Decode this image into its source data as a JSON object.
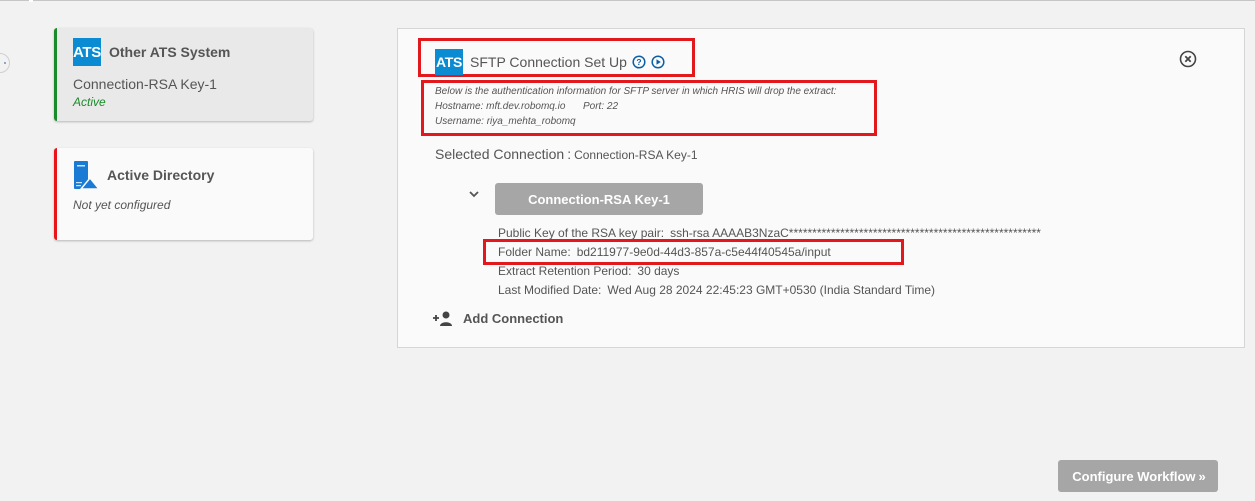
{
  "sidebar": {
    "cards": [
      {
        "logo_text": "ATS",
        "title": "Other ATS System",
        "connection": "Connection-RSA Key-1",
        "status": "Active",
        "status_color": "#1a8a2a",
        "accent": "#1a8a2a",
        "icon": "ats-logo-icon"
      },
      {
        "title": "Active Directory",
        "status": "Not yet configured",
        "accent": "#e8141a",
        "icon": "server-directory-icon"
      }
    ]
  },
  "panel": {
    "logo_text": "ATS",
    "title": "SFTP Connection Set Up",
    "help_icon": "help-circle-icon",
    "play_icon": "play-circle-icon",
    "close_icon": "close-circle-icon",
    "auth_info": {
      "intro": "Below is the authentication information for SFTP server in which HRIS will drop the extract:",
      "hostname_label": "Hostname:",
      "hostname": "mft.dev.robomq.io",
      "port_label": "Port:",
      "port": "22",
      "username_label": "Username:",
      "username": "riya_mehta_robomq"
    },
    "selected_connection_label": "Selected Connection",
    "selected_connection_value": "Connection-RSA Key-1",
    "connection_button": "Connection-RSA Key-1",
    "details": {
      "public_key_label": "Public Key of the RSA key pair:",
      "public_key_value": "ssh-rsa AAAAB3NzaC******************************************************",
      "folder_label": "Folder Name:",
      "folder_value": "bd211977-9e0d-44d3-857a-c5e44f40545a/input",
      "retention_label": "Extract Retention Period:",
      "retention_value": "30 days",
      "modified_label": "Last Modified Date:",
      "modified_value": "Wed Aug 28 2024 22:45:23 GMT+0530 (India Standard Time)"
    },
    "add_connection": "Add Connection"
  },
  "footer": {
    "configure_button": "Configure Workflow",
    "configure_arrows": "»"
  },
  "colors": {
    "brand_blue": "#0b8bd1",
    "highlight_red": "#e3181d",
    "disabled_button": "#a6a6a6"
  }
}
